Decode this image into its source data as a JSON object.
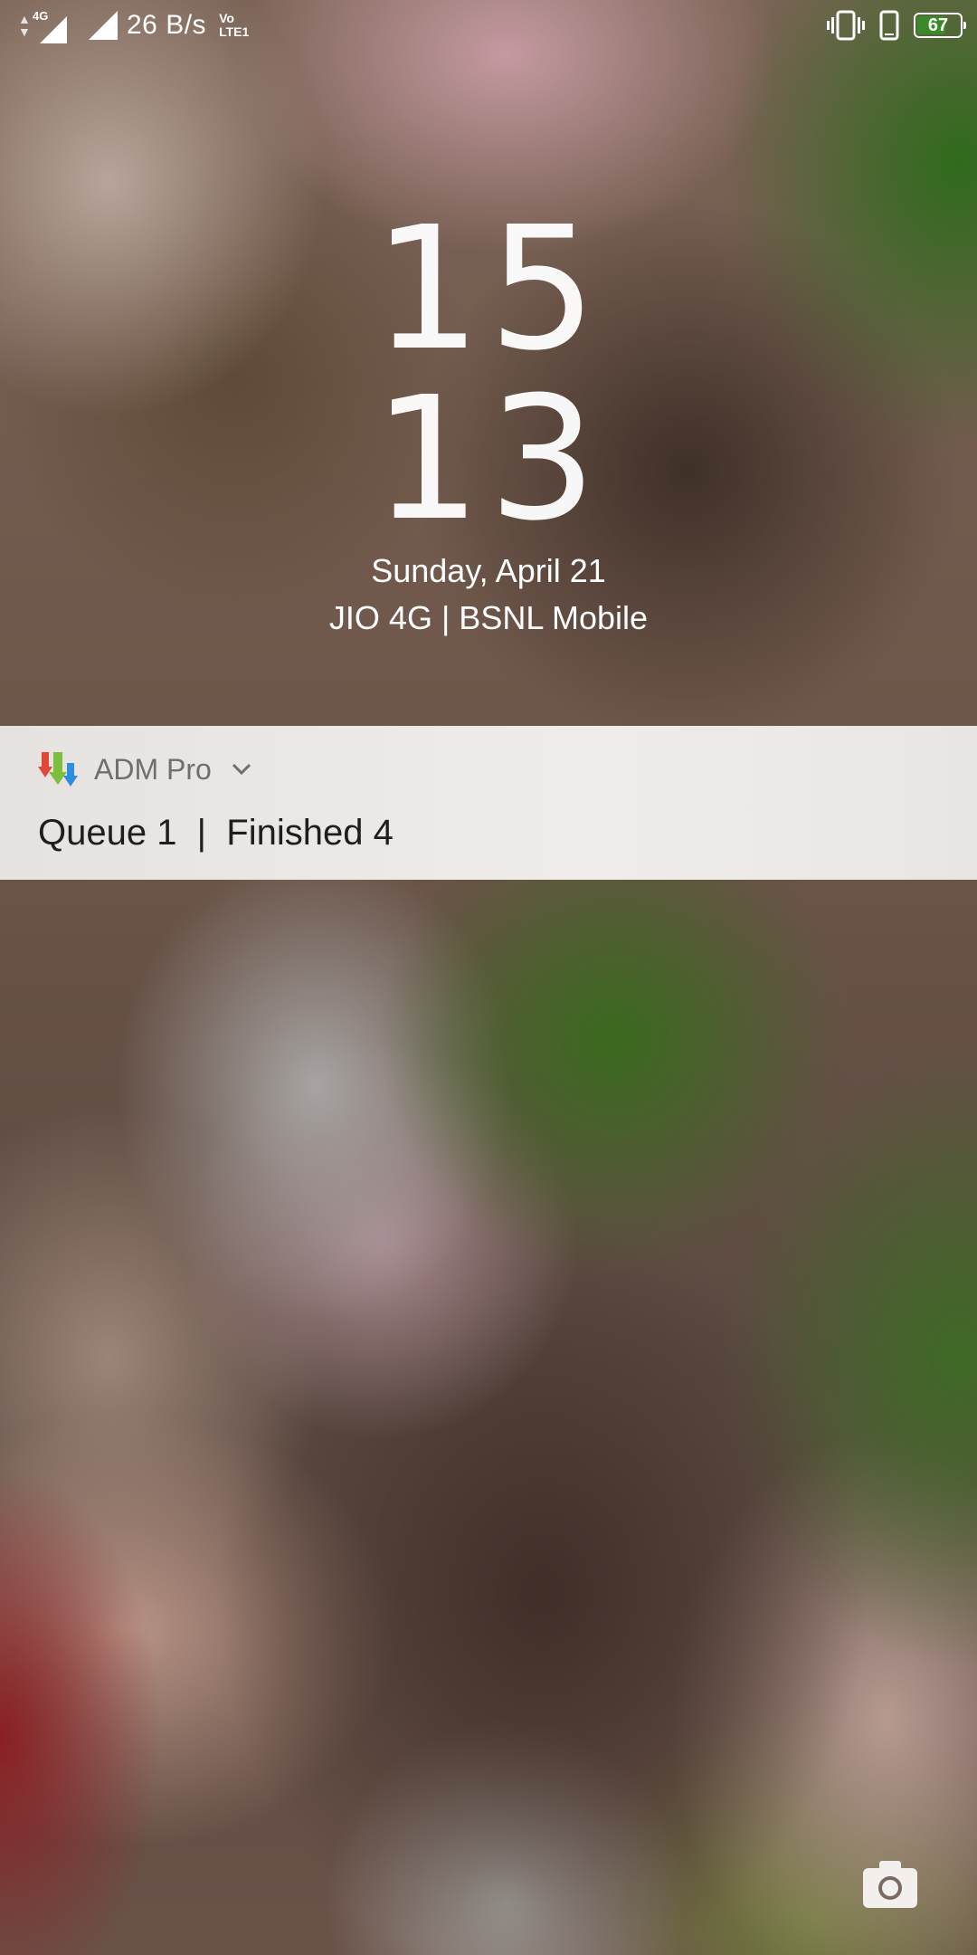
{
  "status_bar": {
    "network_label": "4G",
    "speed": "26 B/s",
    "volte_line1": "Vo",
    "volte_line2": "LTE1",
    "battery_level": "67",
    "battery_fraction": 0.67,
    "icons": [
      "data-activity-icon",
      "signal-1-icon",
      "signal-2-icon",
      "vibrate-icon",
      "phone-icon",
      "battery-icon"
    ]
  },
  "lockscreen": {
    "hour": "15",
    "minute": "13",
    "date": "Sunday, April 21",
    "carrier": "JIO 4G | BSNL Mobile"
  },
  "notification": {
    "app_name": "ADM Pro",
    "app_icon": "adm-download-arrows-icon",
    "message": "Queue 1  |  Finished 4",
    "colors": {
      "arrow_red": "#e0493a",
      "arrow_green": "#7cbf3c",
      "arrow_blue": "#2f8de0"
    }
  },
  "shortcuts": {
    "camera_icon": "camera-icon"
  }
}
